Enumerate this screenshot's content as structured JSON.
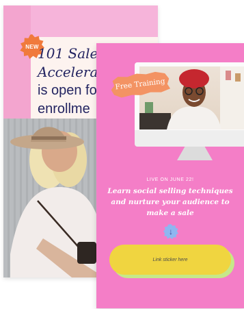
{
  "back_card": {
    "badge": "NEW",
    "title_lines": [
      "101 Sales",
      "Accelera",
      "is open fo",
      "enrollme"
    ]
  },
  "front_card": {
    "tag": "Free Training",
    "live_text": "LIVE ON JUNE 22!",
    "headline": "Learn social selling techniques and nurture your audience to make a sale",
    "arrow_glyph": "↓",
    "link_label": "Link sticker here"
  },
  "colors": {
    "back_pink": "#f6b4da",
    "front_pink": "#f47ec7",
    "navy_text": "#232461",
    "orange_badge": "#f07a3c",
    "yellow_button": "#f0d540",
    "green_shadow": "#c6e88a",
    "blue_badge": "#8fb6f0"
  }
}
